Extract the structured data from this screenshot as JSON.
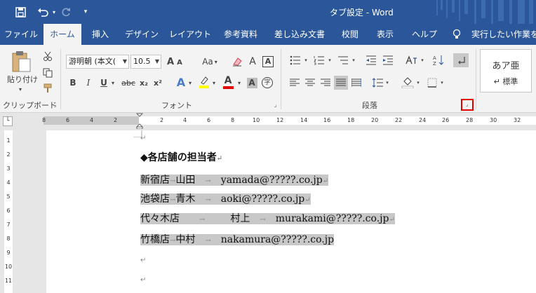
{
  "window": {
    "title": "タブ設定 - Word"
  },
  "quick_access": {
    "save_icon": "save-icon",
    "undo_icon": "undo-icon",
    "redo_icon": "redo-icon",
    "customize_icon": "customize-qat-icon"
  },
  "tabs": [
    {
      "label": "ファイル"
    },
    {
      "label": "ホーム"
    },
    {
      "label": "挿入"
    },
    {
      "label": "デザイン"
    },
    {
      "label": "レイアウト"
    },
    {
      "label": "参考資料"
    },
    {
      "label": "差し込み文書"
    },
    {
      "label": "校閲"
    },
    {
      "label": "表示"
    },
    {
      "label": "ヘルプ"
    },
    {
      "label": "実行したい作業を入"
    }
  ],
  "ribbon": {
    "clipboard": {
      "group_label": "クリップボード",
      "paste_label": "貼り付け"
    },
    "font": {
      "group_label": "フォント",
      "font_name": "游明朝 (本文(",
      "font_size": "10.5",
      "change_case": "Aa",
      "bold": "B",
      "italic": "I",
      "underline": "U",
      "strike": "abc",
      "subscript": "x₂",
      "superscript": "x²",
      "text_effects": "A",
      "font_color": "A",
      "char_shading": "A",
      "enclose": "字",
      "phonetic": "A"
    },
    "paragraph": {
      "group_label": "段落"
    },
    "styles": {
      "sample": "あア亜",
      "name": "↵ 標準"
    }
  },
  "document": {
    "heading": "◆各店舗の担当者",
    "rows": [
      {
        "store": "新宿店",
        "name": "山田",
        "email": "yamada@?????.co.jp"
      },
      {
        "store": "池袋店",
        "name": "青木",
        "email": "aoki@?????.co.jp"
      },
      {
        "store": "代々木店",
        "name": "村上",
        "email": "murakami@?????.co.jp"
      },
      {
        "store": "竹橋店",
        "name": "中村",
        "email": "nakamura@?????.co.jp"
      }
    ],
    "tab_mark": "→",
    "para_mark": "↵"
  },
  "ruler": {
    "left_labels": [
      "8",
      "6",
      "4",
      "2"
    ],
    "right_labels": [
      "2",
      "4",
      "6",
      "8",
      "10",
      "12",
      "14",
      "16",
      "18",
      "20",
      "22",
      "24",
      "26",
      "28",
      "30",
      "32"
    ],
    "vertical_labels": [
      "1",
      "2",
      "3",
      "4",
      "5",
      "6",
      "7",
      "8",
      "9",
      "10",
      "11"
    ]
  },
  "colors": {
    "brand": "#2b579a",
    "selection": "#c8c8c8",
    "highlight_box": "#e00000"
  }
}
